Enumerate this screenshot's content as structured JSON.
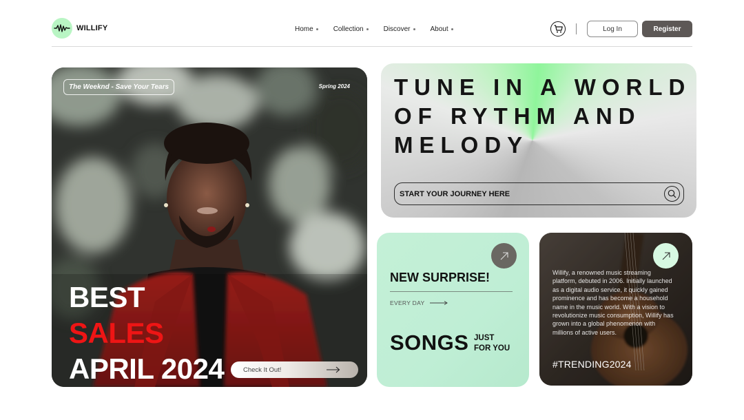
{
  "brand": {
    "name": "WILLIFY",
    "logo_icon": "soundwave-icon",
    "accent": "#b9f5c4"
  },
  "nav": {
    "items": [
      {
        "label": "Home"
      },
      {
        "label": "Collection"
      },
      {
        "label": "Discover"
      },
      {
        "label": "About"
      }
    ]
  },
  "header": {
    "cart_icon": "cart-icon",
    "login_label": "Log In",
    "register_label": "Register"
  },
  "hero": {
    "tag": "The Weeknd - Save Your Tears",
    "season": "Spring 2024",
    "title_line1": "BEST",
    "title_line2": "SALES",
    "title_line3": "APRIL 2024",
    "cta_label": "Check It Out!",
    "highlight_color": "#ee1515"
  },
  "tune": {
    "title_line1": "TUNE IN A WORLD",
    "title_line2": "OF RYTHM AND",
    "title_line3": "MELODY",
    "search_placeholder": "START YOUR JOURNEY HERE"
  },
  "surprise": {
    "title": "NEW SURPRISE!",
    "subtitle": "EVERY DAY",
    "songs": "SONGS",
    "for_you_line1": "JUST",
    "for_you_line2": "FOR YOU"
  },
  "trending": {
    "description": "Willify, a renowned music streaming platform, debuted in 2006. Initially launched as a digital audio service, it quickly gained prominence and has become a household name in the music world. With a vision to revolutionize music consumption, Willify has grown into a global phenomenon with millions of active users.",
    "tag": "#TRENDING2024"
  }
}
